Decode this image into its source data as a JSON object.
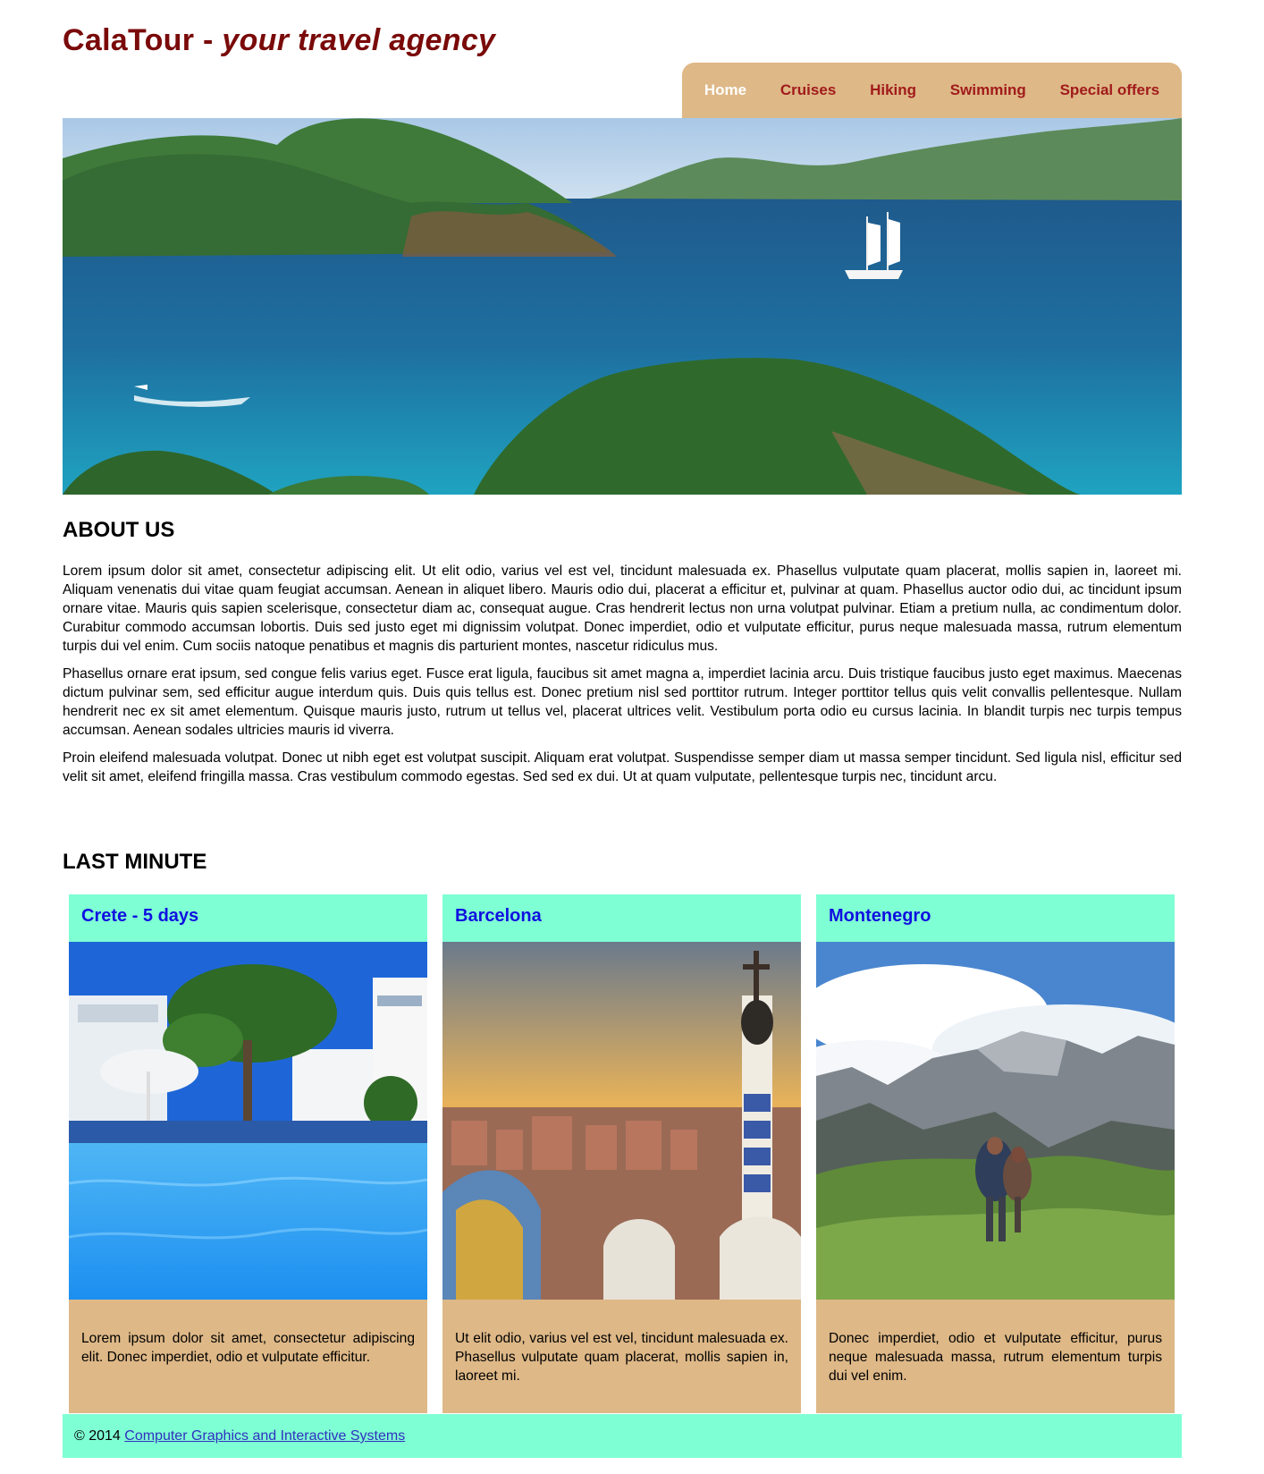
{
  "header": {
    "brand": "CalaTour",
    "separator": "-",
    "tagline": "your travel agency"
  },
  "nav": {
    "items": [
      {
        "label": "Home",
        "active": true
      },
      {
        "label": "Cruises",
        "active": false
      },
      {
        "label": "Hiking",
        "active": false
      },
      {
        "label": "Swimming",
        "active": false
      },
      {
        "label": "Special offers",
        "active": false
      }
    ]
  },
  "about": {
    "title": "ABOUT US",
    "paragraphs": [
      "Lorem ipsum dolor sit amet, consectetur adipiscing elit. Ut elit odio, varius vel est vel, tincidunt malesuada ex. Phasellus vulputate quam placerat, mollis sapien in, laoreet mi. Aliquam venenatis dui vitae quam feugiat accumsan. Aenean in aliquet libero. Mauris odio dui, placerat a efficitur et, pulvinar at quam. Phasellus auctor odio dui, ac tincidunt ipsum ornare vitae. Mauris quis sapien scelerisque, consectetur diam ac, consequat augue. Cras hendrerit lectus non urna volutpat pulvinar. Etiam a pretium nulla, ac condimentum dolor. Curabitur commodo accumsan lobortis. Duis sed justo eget mi dignissim volutpat. Donec imperdiet, odio et vulputate efficitur, purus neque malesuada massa, rutrum elementum turpis dui vel enim. Cum sociis natoque penatibus et magnis dis parturient montes, nascetur ridiculus mus.",
      "Phasellus ornare erat ipsum, sed congue felis varius eget. Fusce erat ligula, faucibus sit amet magna a, imperdiet lacinia arcu. Duis tristique faucibus justo eget maximus. Maecenas dictum pulvinar sem, sed efficitur augue interdum quis. Duis quis tellus est. Donec pretium nisl sed porttitor rutrum. Integer porttitor tellus quis velit convallis pellentesque. Nullam hendrerit nec ex sit amet elementum. Quisque mauris justo, rutrum ut tellus vel, placerat ultrices velit. Vestibulum porta odio eu cursus lacinia. In blandit turpis nec turpis tempus accumsan. Aenean sodales ultricies mauris id viverra.",
      "Proin eleifend malesuada volutpat. Donec ut nibh eget est volutpat suscipit. Aliquam erat volutpat. Suspendisse semper diam ut massa semper tincidunt. Sed ligula nisl, efficitur sed velit sit amet, eleifend fringilla massa. Cras vestibulum commodo egestas. Sed sed ex dui. Ut at quam vulputate, pellentesque turpis nec, tincidunt arcu."
    ]
  },
  "last_minute": {
    "title": "LAST MINUTE",
    "cards": [
      {
        "title": "Crete - 5 days",
        "text": "Lorem ipsum dolor sit amet, consectetur adipiscing elit. Donec imperdiet, odio et vulputate efficitur."
      },
      {
        "title": "Barcelona",
        "text": "Ut elit odio, varius vel est vel, tincidunt malesuada ex. Phasellus vulputate quam placerat, mollis sapien in, laoreet mi."
      },
      {
        "title": "Montenegro",
        "text": "Donec imperdiet, odio et vulputate efficitur, purus neque malesuada massa, rutrum elementum turpis dui vel enim."
      }
    ]
  },
  "footer": {
    "copyright": "© 2014",
    "link_text": "Computer Graphics and Interactive Systems"
  },
  "colors": {
    "brand": "#7a0a0a",
    "nav_bg": "#deb887",
    "nav_link": "#a11b1b",
    "card_head_bg": "#7fffd4",
    "card_title": "#1010e0"
  }
}
